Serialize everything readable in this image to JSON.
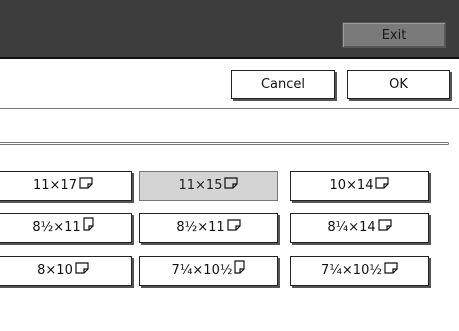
{
  "header": {
    "exit_label": "Exit"
  },
  "actions": {
    "cancel_label": "Cancel",
    "ok_label": "OK"
  },
  "paper_sizes": {
    "selected": "11×15",
    "rows": [
      [
        {
          "label": "11×17",
          "orientation": "landscape"
        },
        {
          "label": "11×15",
          "orientation": "landscape"
        },
        {
          "label": "10×14",
          "orientation": "landscape"
        }
      ],
      [
        {
          "label": "8½×11",
          "orientation": "portrait"
        },
        {
          "label": "8½×11",
          "orientation": "landscape"
        },
        {
          "label": "8¼×14",
          "orientation": "landscape"
        }
      ],
      [
        {
          "label": "8×10",
          "orientation": "landscape"
        },
        {
          "label": "7¼×10½",
          "orientation": "portrait"
        },
        {
          "label": "7¼×10½",
          "orientation": "landscape"
        }
      ]
    ]
  },
  "colors": {
    "header_bg": "#3c3c3c",
    "exit_bg": "#7a7a7a",
    "selected_bg": "#d4d4d4"
  }
}
